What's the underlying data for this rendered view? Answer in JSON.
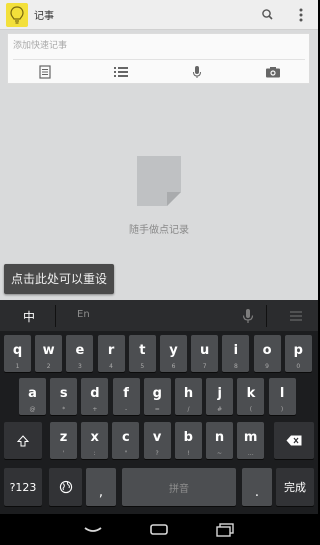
{
  "app": {
    "title": "记事"
  },
  "composer": {
    "placeholder": "添加快速记事",
    "buttons": [
      {
        "name": "text-note-button",
        "icon": "document-icon"
      },
      {
        "name": "list-note-button",
        "icon": "list-icon"
      },
      {
        "name": "voice-note-button",
        "icon": "microphone-icon"
      },
      {
        "name": "photo-note-button",
        "icon": "camera-icon"
      }
    ]
  },
  "empty_state": {
    "text": "随手做点记录"
  },
  "tooltip": {
    "text": "点击此处可以重设"
  },
  "keyboard": {
    "mode_label": "中",
    "candidate_hint": "En",
    "row1": [
      {
        "k": "q",
        "s": "1"
      },
      {
        "k": "w",
        "s": "2"
      },
      {
        "k": "e",
        "s": "3"
      },
      {
        "k": "r",
        "s": "4"
      },
      {
        "k": "t",
        "s": "5"
      },
      {
        "k": "y",
        "s": "6"
      },
      {
        "k": "u",
        "s": "7"
      },
      {
        "k": "i",
        "s": "8"
      },
      {
        "k": "o",
        "s": "9"
      },
      {
        "k": "p",
        "s": "0"
      }
    ],
    "row2": [
      {
        "k": "a",
        "s": "@"
      },
      {
        "k": "s",
        "s": "*"
      },
      {
        "k": "d",
        "s": "+"
      },
      {
        "k": "f",
        "s": "-"
      },
      {
        "k": "g",
        "s": "="
      },
      {
        "k": "h",
        "s": "/"
      },
      {
        "k": "j",
        "s": "#"
      },
      {
        "k": "k",
        "s": "("
      },
      {
        "k": "l",
        "s": ")"
      }
    ],
    "row3": [
      {
        "k": "z",
        "s": "'"
      },
      {
        "k": "x",
        "s": ":"
      },
      {
        "k": "c",
        "s": "\""
      },
      {
        "k": "v",
        "s": "?"
      },
      {
        "k": "b",
        "s": "!"
      },
      {
        "k": "n",
        "s": "~"
      },
      {
        "k": "m",
        "s": "…"
      }
    ],
    "symbols_label": "?123",
    "comma_label": ",",
    "space_label": "拼音",
    "period_label": ".",
    "done_label": "完成"
  },
  "colors": {
    "accent_yellow": "#f3e03a",
    "keyboard_bg": "#1c1d1f",
    "key_bg": "#4c4e51"
  }
}
